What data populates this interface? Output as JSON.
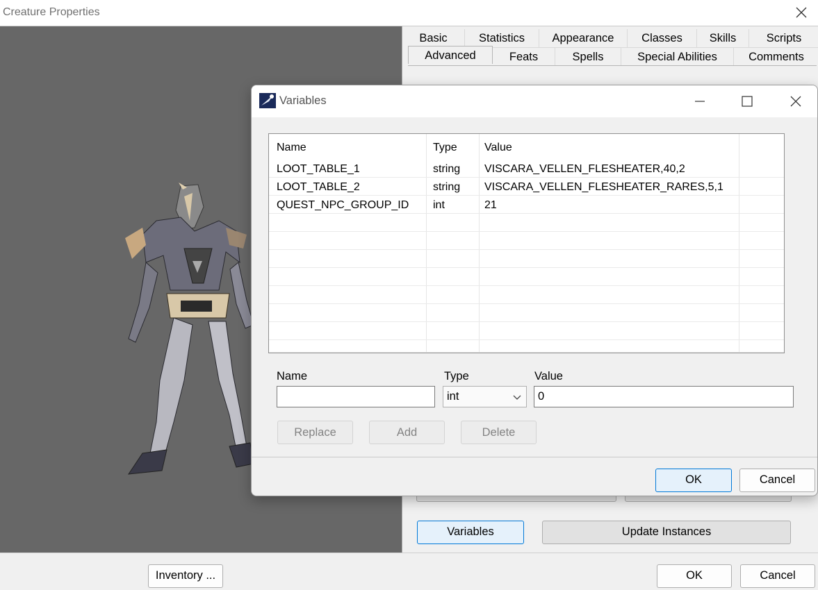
{
  "main": {
    "title": "Creature Properties",
    "tabs_row1": [
      "Basic",
      "Statistics",
      "Appearance",
      "Classes",
      "Skills",
      "Scripts"
    ],
    "tabs_row2": [
      "Advanced",
      "Feats",
      "Spells",
      "Special Abilities",
      "Comments"
    ],
    "active_tab": "Advanced",
    "variables_button": "Variables",
    "update_instances_button": "Update Instances",
    "inventory_button": "Inventory ...",
    "ok_button": "OK",
    "cancel_button": "Cancel"
  },
  "dialog": {
    "title": "Variables",
    "columns": [
      "Name",
      "Type",
      "Value"
    ],
    "rows": [
      {
        "name": "LOOT_TABLE_1",
        "type": "string",
        "value": "VISCARA_VELLEN_FLESHEATER,40,2"
      },
      {
        "name": "LOOT_TABLE_2",
        "type": "string",
        "value": "VISCARA_VELLEN_FLESHEATER_RARES,5,1"
      },
      {
        "name": "QUEST_NPC_GROUP_ID",
        "type": "int",
        "value": "21"
      }
    ],
    "form": {
      "name_label": "Name",
      "type_label": "Type",
      "value_label": "Value",
      "name_value": "",
      "type_value": "int",
      "value_value": "0"
    },
    "replace_button": "Replace",
    "add_button": "Add",
    "delete_button": "Delete",
    "ok_button": "OK",
    "cancel_button": "Cancel"
  },
  "colors": {
    "preview_bg": "#676767",
    "focus_border": "#0078d7",
    "window_bg": "#f0f0f0"
  }
}
